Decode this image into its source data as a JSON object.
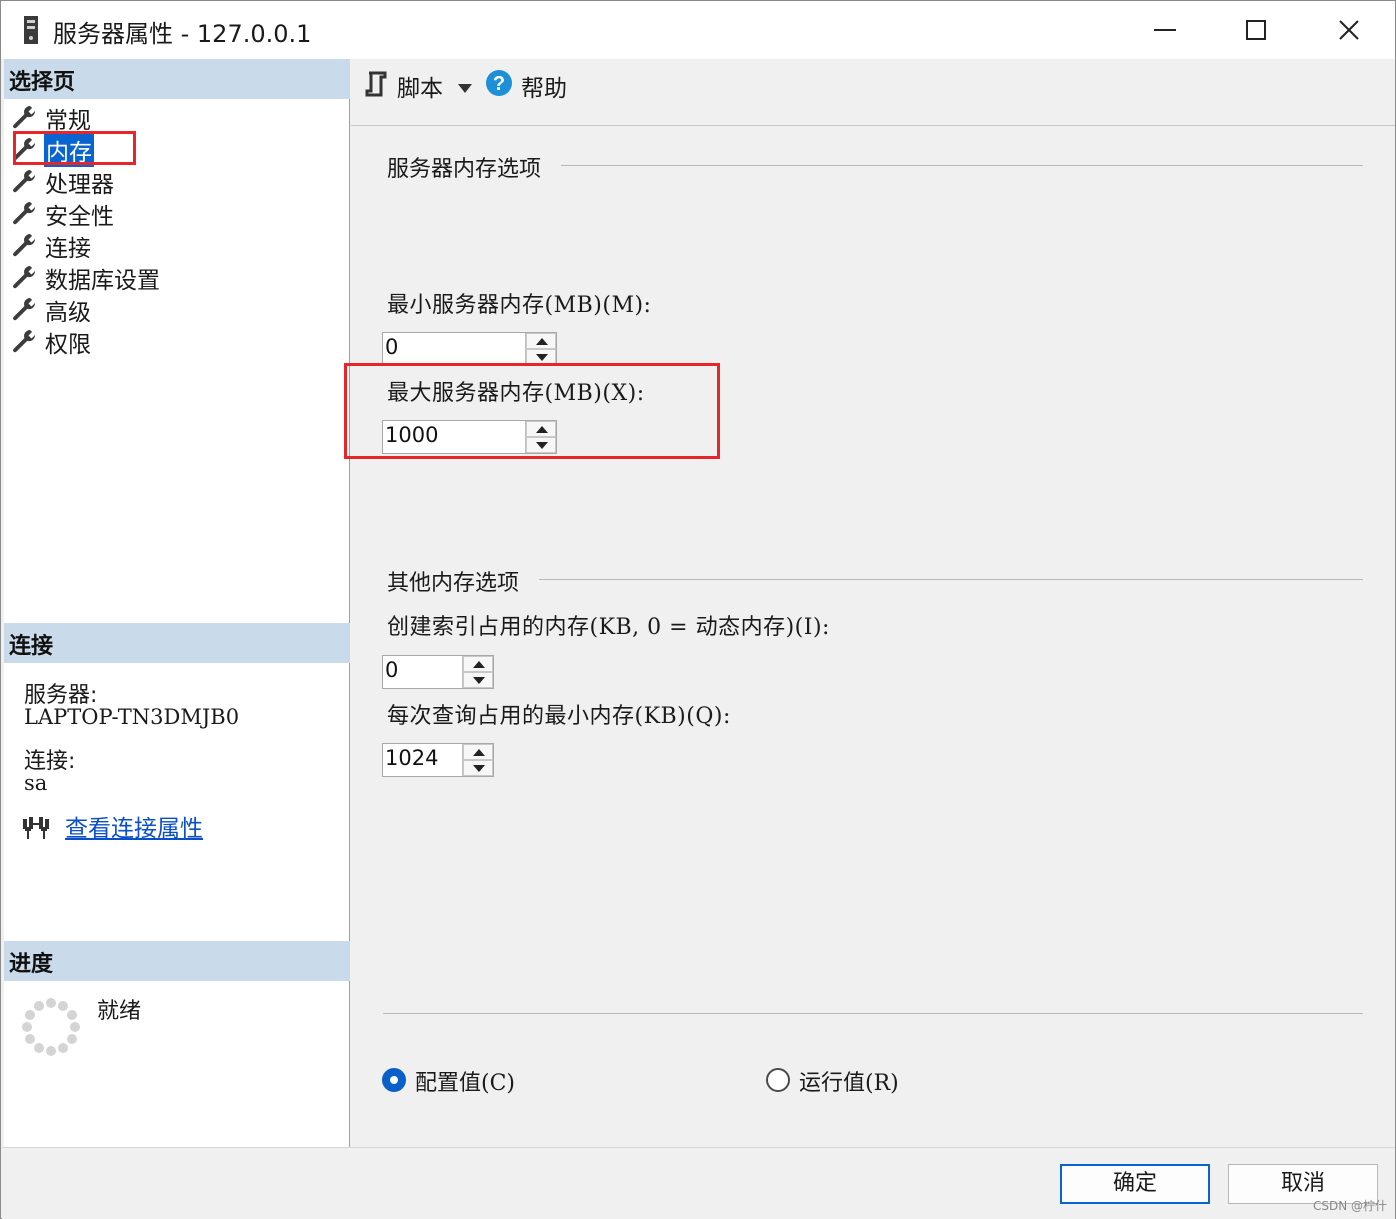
{
  "window": {
    "title": "服务器属性 - 127.0.0.1",
    "icon": "server-icon",
    "controls": {
      "minimize": "minimize-icon",
      "maximize": "maximize-icon",
      "close": "close-icon"
    }
  },
  "left": {
    "pages_header": "选择页",
    "pages": [
      {
        "label": "常规",
        "icon": "wrench-icon"
      },
      {
        "label": "内存",
        "icon": "wrench-icon",
        "selected": true
      },
      {
        "label": "处理器",
        "icon": "wrench-icon"
      },
      {
        "label": "安全性",
        "icon": "wrench-icon"
      },
      {
        "label": "连接",
        "icon": "wrench-icon"
      },
      {
        "label": "数据库设置",
        "icon": "wrench-icon"
      },
      {
        "label": "高级",
        "icon": "wrench-icon"
      },
      {
        "label": "权限",
        "icon": "wrench-icon"
      }
    ],
    "connection_header": "连接",
    "server_label": "服务器:",
    "server_value": "LAPTOP-TN3DMJB0",
    "connection_label": "连接:",
    "connection_value": "sa",
    "view_link": "查看连接属性",
    "progress_header": "进度",
    "progress_status": "就绪"
  },
  "toolbar": {
    "script_label": "脚本",
    "help_label": "帮助"
  },
  "main": {
    "server_memory_group": "服务器内存选项",
    "min_label": "最小服务器内存(MB)(M):",
    "min_value": "0",
    "max_label": "最大服务器内存(MB)(X):",
    "max_value": "1000",
    "other_group": "其他内存选项",
    "index_label": "创建索引占用的内存(KB, 0 = 动态内存)(I):",
    "index_value": "0",
    "query_label": "每次查询占用的最小内存(KB)(Q):",
    "query_value": "1024",
    "radio_config": "配置值(C)",
    "radio_running": "运行值(R)",
    "selected_radio": "config"
  },
  "buttons": {
    "ok": "确定",
    "cancel": "取消"
  },
  "watermark": "CSDN @柠什",
  "colors": {
    "selection": "#0a64d0",
    "section_header": "#c9daea",
    "link": "#0a4fc7",
    "annotation": "#e8262a"
  }
}
